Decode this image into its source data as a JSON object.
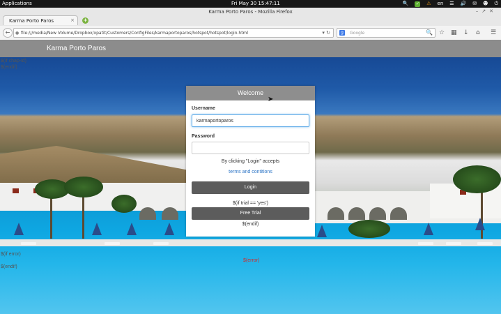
{
  "system_bar": {
    "applications": "Applications",
    "clock": "Fri May 30 15:47:11",
    "lang": "en"
  },
  "window": {
    "title": "Karma Porto Paros - Mozilla Firefox"
  },
  "tab": {
    "title": "Karma Porto Paros"
  },
  "address_bar": {
    "url": "file:///media/New Volume/Dropbox/xpatit/Customers/ConfigFiles/karmaportoparos/hotspot/hotspot/login.html"
  },
  "search_bar": {
    "placeholder": "Google"
  },
  "page": {
    "brand": "Karma Porto Paros",
    "tmpl_top_1": "$(if chap-id)",
    "tmpl_top_2": "$(endif)",
    "tmpl_error_1": "$(if error)",
    "tmpl_error_2": "$(endif)",
    "error_var": "$(error)"
  },
  "login": {
    "heading": "Welcome",
    "username_label": "Username",
    "username_value": "karmaportoparos",
    "password_label": "Password",
    "password_value": "",
    "accept_text": "By clicking \"Login\" accepts",
    "terms_link": "terms and contitions",
    "login_button": "Login",
    "trial_if": "$(if trial == 'yes')",
    "trial_button": "Free Trial",
    "trial_endif": "$(endif)"
  },
  "colors": {
    "header_bg": "#8c8c8c",
    "button_bg": "#5c5c5c",
    "link": "#2a73c5",
    "error": "#d12a2a"
  }
}
